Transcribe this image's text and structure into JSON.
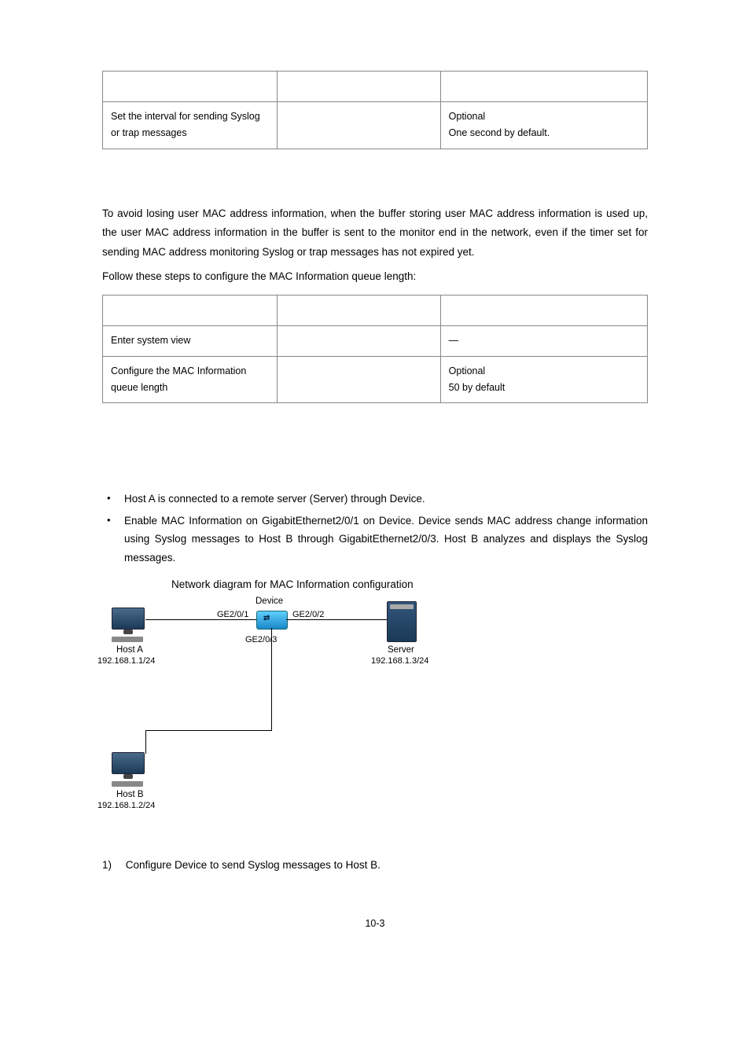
{
  "table1": {
    "row1": {
      "c1": "Set the interval for sending Syslog or trap messages",
      "c3a": "Optional",
      "c3b": "One second by default."
    }
  },
  "para1": "To avoid losing user MAC address information, when the buffer storing user MAC address information is used up, the user MAC address information in the buffer is sent to the monitor end in the network, even if the timer set for sending MAC address monitoring Syslog or trap messages has not expired yet.",
  "follow": "Follow these steps to configure the MAC Information queue length:",
  "table2": {
    "row1": {
      "c1": "Enter system view",
      "c3": "—"
    },
    "row2": {
      "c1": "Configure the MAC Information queue length",
      "c3a": "Optional",
      "c3b": "50 by default"
    }
  },
  "bullets": {
    "b1": "Host A is connected to a remote server (Server) through Device.",
    "b2": "Enable MAC Information on GigabitEthernet2/0/1 on Device. Device sends MAC address change information using Syslog messages to Host B through GigabitEthernet2/0/3. Host B analyzes and displays the Syslog messages."
  },
  "figcap": "Network diagram for MAC Information configuration",
  "diagram": {
    "device": "Device",
    "ge201": "GE2/0/1",
    "ge202": "GE2/0/2",
    "ge203": "GE2/0/3",
    "hostA": "Host A",
    "hostAip": "192.168.1.1/24",
    "server": "Server",
    "serverip": "192.168.1.3/24",
    "hostB": "Host B",
    "hostBip": "192.168.1.2/24"
  },
  "step1": {
    "num": "1)",
    "text": "Configure Device to send Syslog messages to Host B."
  },
  "pagenum": "10-3"
}
